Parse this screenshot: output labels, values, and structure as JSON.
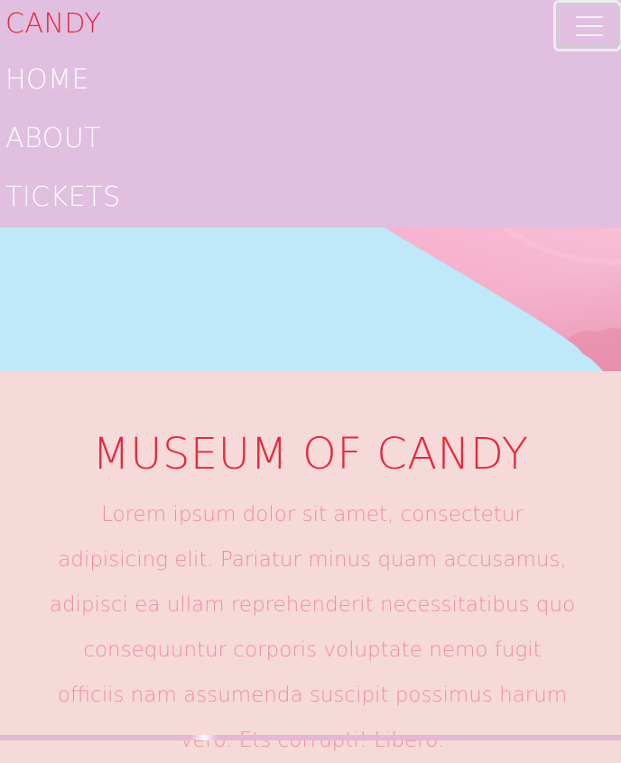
{
  "navbar": {
    "brand": "CANDY",
    "toggle_icon": "hamburger-menu-icon",
    "links": [
      {
        "label": "HOME"
      },
      {
        "label": "ABOUT"
      },
      {
        "label": "TICKETS"
      }
    ]
  },
  "hero": {
    "image": "pink-candy-wrapper-on-light-blue-background"
  },
  "main": {
    "title": "MUSEUM OF CANDY",
    "paragraph": "Lorem ipsum dolor sit amet, consectetur adipisicing elit. Pariatur minus quam accusamus, adipisci ea ullam reprehenderit necessitatibus quo consequuntur corporis voluptate nemo fugit officiis nam assumenda suscipit possimus harum vero. Ets corrupti! Libero."
  },
  "colors": {
    "navbar_bg": "#e0bfe1",
    "brand": "#e8283a",
    "nav_link": "#ffffff",
    "hero_bg": "#bfe9f8",
    "hero_candy": "#f7a6c8",
    "content_bg": "#f6d9d9",
    "title": "#e8283a",
    "paragraph": "#ef8e9a"
  }
}
